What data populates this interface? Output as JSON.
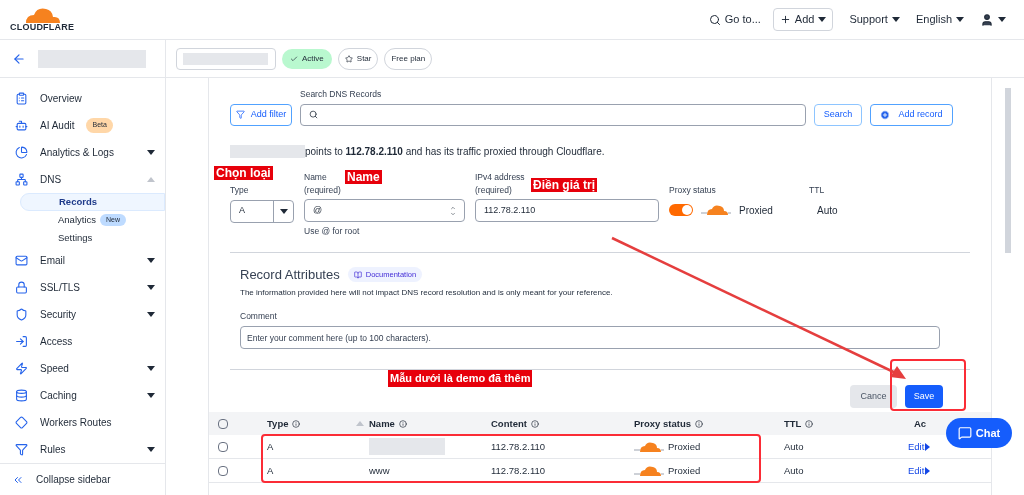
{
  "header": {
    "logo": "CLOUDFLARE",
    "goto": "Go to...",
    "add": "Add",
    "support": "Support",
    "language": "English"
  },
  "zone_bar": {
    "status": "Active",
    "star": "Star",
    "plan": "Free plan"
  },
  "sidebar": {
    "items": [
      {
        "label": "Overview"
      },
      {
        "label": "AI Audit",
        "badge": "Beta"
      },
      {
        "label": "Analytics & Logs",
        "expanded": false
      },
      {
        "label": "DNS",
        "expanded": true,
        "children": [
          {
            "label": "Records",
            "selected": true
          },
          {
            "label": "Analytics",
            "badge": "New",
            "selected": false
          },
          {
            "label": "Settings",
            "selected": false
          }
        ]
      },
      {
        "label": "Email",
        "expanded": false
      },
      {
        "label": "SSL/TLS",
        "expanded": false
      },
      {
        "label": "Security",
        "expanded": false
      },
      {
        "label": "Access"
      },
      {
        "label": "Speed",
        "expanded": false
      },
      {
        "label": "Caching",
        "expanded": false
      },
      {
        "label": "Workers Routes"
      },
      {
        "label": "Rules",
        "expanded": false
      }
    ],
    "collapse": "Collapse sidebar"
  },
  "toolbar": {
    "filter": "Add filter",
    "search_label": "Search DNS Records",
    "search_button": "Search",
    "add_record": "Add record"
  },
  "summary": "points to **112.78.2.110** and has its traffic proxied through Cloudflare.",
  "form": {
    "type_label": "Type",
    "type_value": "A",
    "name_label": "Name",
    "name_required": "(required)",
    "name_value": "@",
    "name_hint": "Use @ for root",
    "ipv4_label": "IPv4 address",
    "ipv4_required": "(required)",
    "ipv4_value": "112.78.2.110",
    "proxy_label": "Proxy status",
    "proxy_on": true,
    "proxy_text": "Proxied",
    "ttl_label": "TTL",
    "ttl_value": "Auto"
  },
  "attributes": {
    "title": "Record Attributes",
    "doc_link": "Documentation",
    "info": "The information provided here will not impact DNS record resolution and is only meant for your reference.",
    "comment_label": "Comment",
    "comment_placeholder": "Enter your comment here (up to 100 characters)."
  },
  "actions": {
    "cancel": "Cance",
    "save": "Save"
  },
  "table": {
    "all_checked": false,
    "columns": [
      "Type",
      "Name",
      "Content",
      "Proxy status",
      "TTL",
      "Ac"
    ],
    "rows": [
      {
        "type": "A",
        "name": "",
        "content": "112.78.2.110",
        "proxy": "Proxied",
        "ttl": "Auto",
        "action": "Edit",
        "checked": false
      },
      {
        "type": "A",
        "name": "www",
        "content": "112.78.2.110",
        "proxy": "Proxied",
        "ttl": "Auto",
        "action": "Edit",
        "checked": false
      }
    ]
  },
  "chat": "Chat",
  "annotations": {
    "type": "Chọn loại",
    "name": "Name",
    "value": "Điền giá trị",
    "demo": "Mẫu dưới là demo đã thêm"
  }
}
